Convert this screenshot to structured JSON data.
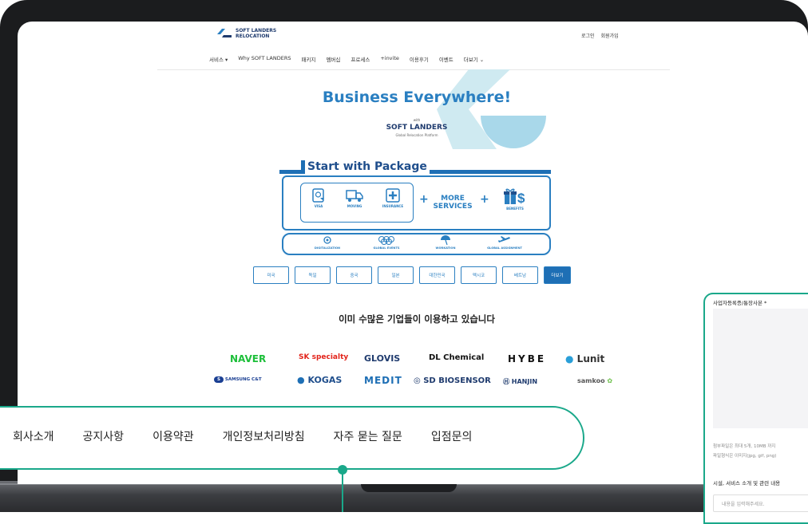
{
  "header": {
    "logo_line1": "SOFT LANDERS",
    "logo_line2": "RELOCATION",
    "login": "로그인",
    "signup": "회원가입",
    "nav": [
      "서비스 ▾",
      "Why SOFT LANDERS",
      "패키지",
      "멤버십",
      "프로세스",
      "+invite",
      "이용후기",
      "이벤트",
      "더보기 ⌄"
    ]
  },
  "hero": {
    "title": "Business Everywhere!",
    "with": "with",
    "brand": "SOFT LANDERS",
    "sub": "Global Relocation Platform"
  },
  "package": {
    "title": "Start with Package",
    "items": [
      "VISA",
      "MOVING",
      "INSURANCE"
    ],
    "more_line1": "MORE",
    "more_line2": "SERVICES",
    "benefits": "BENEFITS",
    "services": [
      "DIGITALIZATION",
      "GLOBAL EVENTS",
      "WORKATION",
      "GLOBAL ASSIGNMENT"
    ]
  },
  "countries": [
    "미국",
    "독일",
    "중국",
    "일본",
    "대한민국",
    "멕시코",
    "베트남",
    "더보기"
  ],
  "clients": {
    "title": "이미 수많은 기업들이 이용하고 있습니다",
    "row1": [
      "NAVER",
      "SK specialty",
      "GLOVIS",
      "DL Chemical",
      "HYBE",
      "Lunit"
    ],
    "row2": [
      "SAMSUNG C&T",
      "KOGAS",
      "MEDIT",
      "SD BIOSENSOR",
      "HANJIN",
      "samkoo"
    ]
  },
  "footer_nav": [
    "회사소개",
    "공지사항",
    "이용약관",
    "개인정보처리방침",
    "자주 묻는 질문",
    "입점문의"
  ],
  "form": {
    "label_biz": "사업자등록증/통장사본 *",
    "note1": "첨부파일은 최대 5개, 10MB 까지",
    "note2": "파일형식은 이미지(jpg, gif, png)",
    "label_intro": "시설, 서비스 소개 및 관련 내용",
    "placeholder": "내용을 입력해주세요."
  },
  "colors": {
    "accent": "#2a7fc1",
    "navy": "#1f3b6e",
    "teal": "#1aa88a"
  }
}
